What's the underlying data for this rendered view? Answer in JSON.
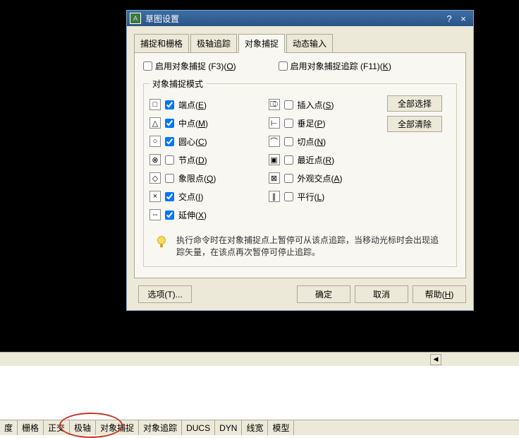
{
  "titlebar": {
    "title": "草图设置",
    "help": "?",
    "close": "×"
  },
  "tabs": [
    "捕捉和栅格",
    "极轴追踪",
    "对象捕捉",
    "动态输入"
  ],
  "activeTab": 2,
  "osnap": {
    "enable": "启用对象捕捉 (F3)(",
    "enable_u": "O",
    "enable_end": ")",
    "track": "启用对象捕捉追踪 (F11)(",
    "track_u": "K",
    "track_end": ")"
  },
  "group": "对象捕捉模式",
  "left": [
    {
      "sym": "□",
      "label": "端点(",
      "u": "E",
      "end": ")",
      "chk": true
    },
    {
      "sym": "△",
      "label": "中点(",
      "u": "M",
      "end": ")",
      "chk": true
    },
    {
      "sym": "○",
      "label": "圆心(",
      "u": "C",
      "end": ")",
      "chk": true
    },
    {
      "sym": "⊗",
      "label": "节点(",
      "u": "D",
      "end": ")",
      "chk": false
    },
    {
      "sym": "◇",
      "label": "象限点(",
      "u": "Q",
      "end": ")",
      "chk": false
    },
    {
      "sym": "×",
      "label": "交点(",
      "u": "I",
      "end": ")",
      "chk": true
    },
    {
      "sym": "--",
      "label": "延伸(",
      "u": "X",
      "end": ")",
      "chk": true
    }
  ],
  "right": [
    {
      "sym": "⎄",
      "label": "插入点(",
      "u": "S",
      "end": ")",
      "chk": false
    },
    {
      "sym": "⊢",
      "label": "垂足(",
      "u": "P",
      "end": ")",
      "chk": false
    },
    {
      "sym": "⌒",
      "label": "切点(",
      "u": "N",
      "end": ")",
      "chk": false
    },
    {
      "sym": "▣",
      "label": "最近点(",
      "u": "R",
      "end": ")",
      "chk": false
    },
    {
      "sym": "⊠",
      "label": "外观交点(",
      "u": "A",
      "end": ")",
      "chk": false
    },
    {
      "sym": "∥",
      "label": "平行(",
      "u": "L",
      "end": ")",
      "chk": false
    }
  ],
  "btns": {
    "selAll": "全部选择",
    "clrAll": "全部清除"
  },
  "tip": "执行命令时在对象捕捉点上暂停可从该点追踪，当移动光标时会出现追踪矢量，在该点再次暂停可停止追踪。",
  "dlg": {
    "options": "选项(T)...",
    "ok": "确定",
    "cancel": "取消",
    "help": "帮助(",
    "help_u": "H",
    "help_end": ")"
  },
  "status": [
    "度",
    "栅格",
    "正交",
    "极轴",
    "对象捕捉",
    "对象追踪",
    "DUCS",
    "DYN",
    "线宽",
    "模型"
  ]
}
